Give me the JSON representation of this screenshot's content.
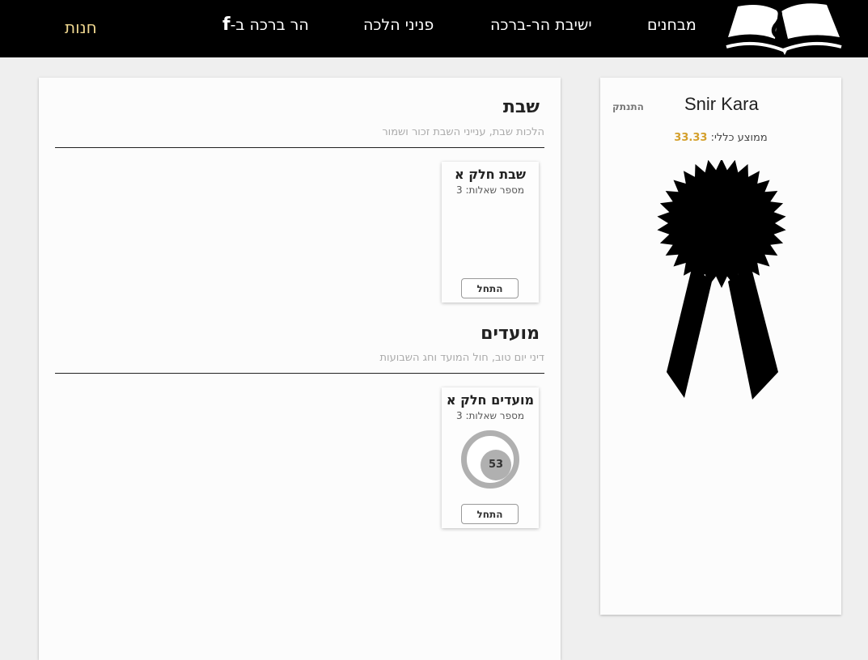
{
  "nav": {
    "exams": "מבחנים",
    "yeshiva": "ישיבת הר-ברכה",
    "pninei": "פניני הלכה",
    "facebook_label": "הר ברכה ב-",
    "facebook_icon": "facebook-icon",
    "shop": "חנות",
    "shop_color": "#f0d890"
  },
  "sections": [
    {
      "title": "שבת",
      "subtitle": "הלכות שבת, ענייני השבת זכור ושמור",
      "exam": {
        "title": "שבת חלק א",
        "questions": "מספר שאלות: 3",
        "button": "התחל"
      }
    },
    {
      "title": "מועדים",
      "subtitle": "דיני יום טוב, חול המועד וחג השבועות",
      "exam": {
        "title": "מועדים חלק א",
        "questions": "מספר שאלות: 3",
        "score": "53",
        "button": "התחל"
      }
    }
  ],
  "profile": {
    "name": "Snir Kara",
    "logout": "התנתק",
    "average_label": "ממוצע כללי:",
    "average_value": "33.33",
    "average_color": "#d4a02c",
    "badge_icon": "award-ribbon-icon"
  }
}
